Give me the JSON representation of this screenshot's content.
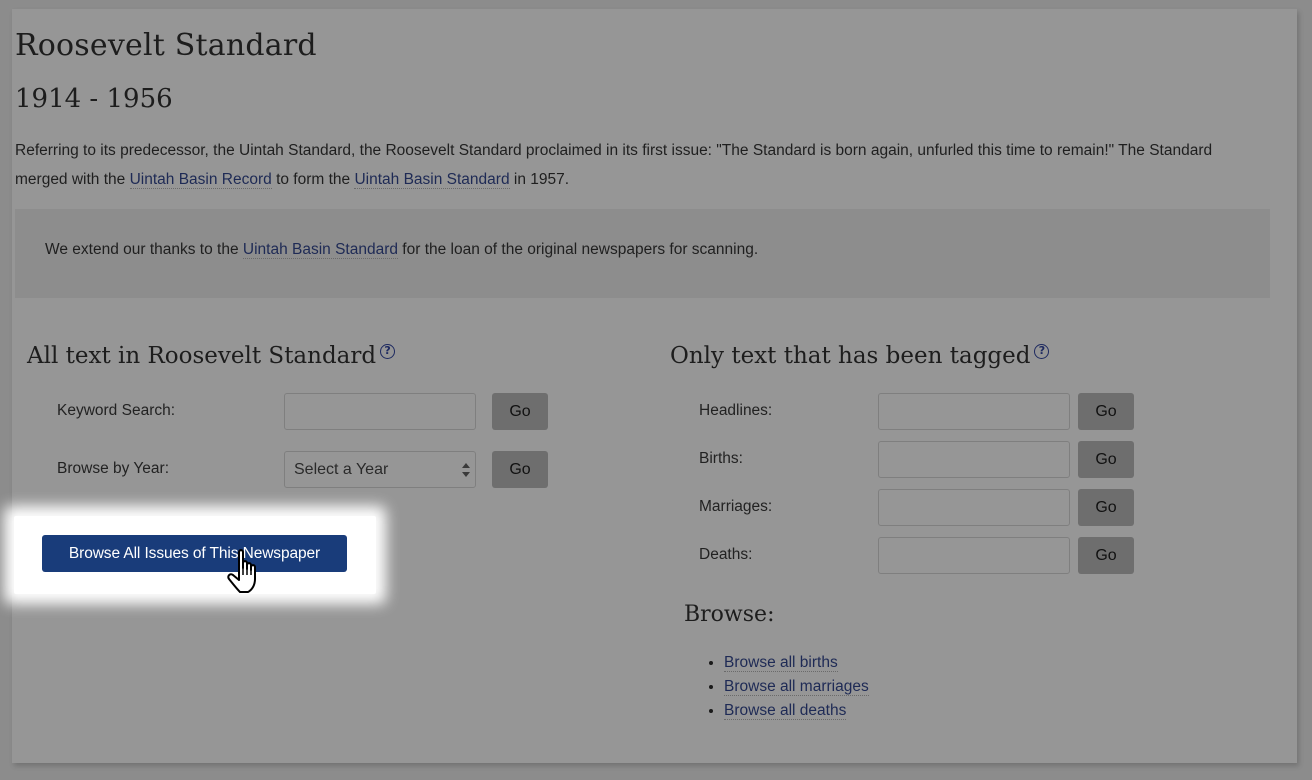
{
  "header": {
    "title": "Roosevelt Standard",
    "years": "1914 - 1956"
  },
  "description": {
    "part1": "Referring to its predecessor, the Uintah Standard, the Roosevelt Standard proclaimed in its first issue: \"The Standard is born again, unfurled this time to remain!\" The Standard merged with the ",
    "link1": "Uintah Basin Record",
    "part2": " to form the ",
    "link2": "Uintah Basin Standard",
    "part3": " in 1957."
  },
  "thanks": {
    "before": "We extend our thanks to the ",
    "link": "Uintah Basin Standard",
    "after": " for the loan of the original newspapers for scanning."
  },
  "all_text": {
    "title": "All text in Roosevelt Standard",
    "help_icon": "?",
    "keyword_label": "Keyword Search:",
    "keyword_value": "",
    "year_label": "Browse by Year:",
    "year_selected": "Select a Year",
    "go_label": "Go",
    "browse_all_button": "Browse All Issues of This Newspaper"
  },
  "tagged": {
    "title": "Only text that has been tagged",
    "help_icon": "?",
    "go_label": "Go",
    "fields": [
      {
        "label": "Headlines:",
        "value": ""
      },
      {
        "label": "Births:",
        "value": ""
      },
      {
        "label": "Marriages:",
        "value": ""
      },
      {
        "label": "Deaths:",
        "value": ""
      }
    ]
  },
  "browse": {
    "title": "Browse:",
    "links": [
      "Browse all births",
      "Browse all marriages",
      "Browse all deaths"
    ]
  },
  "colors": {
    "button_blue": "#193c7a",
    "link": "#1e2a55",
    "overlay": "#969696"
  },
  "cursor": "hand-pointer"
}
